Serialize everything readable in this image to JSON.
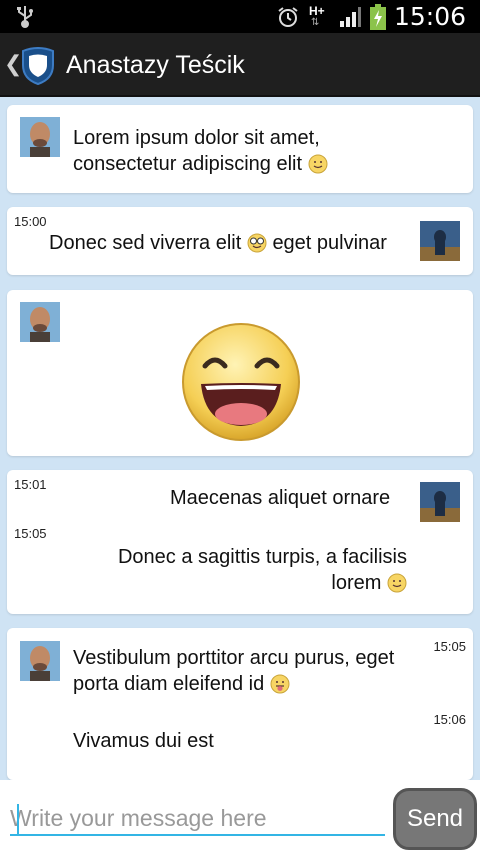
{
  "status_bar": {
    "time": "15:06",
    "network_type": "H+",
    "icons": [
      "usb-icon",
      "alarm-icon",
      "signal-icon",
      "battery-charging-icon"
    ]
  },
  "action_bar": {
    "title": "Anastazy Teścik",
    "icons": [
      "back-chevron-icon",
      "shield-logo-icon"
    ]
  },
  "messages": [
    {
      "text": "Lorem ipsum dolor sit amet, consectetur adipiscing elit",
      "line1": "Lorem ipsum dolor sit amet,",
      "line2": "consectetur adipiscing elit",
      "emoji": "smile",
      "sender": "contact"
    },
    {
      "time": "15:00",
      "text_a": "Donec sed viverra elit",
      "text_b": "eget pulvinar",
      "emoji": "nerd",
      "sender": "me"
    },
    {
      "emoji": "laughing-large",
      "sender": "contact"
    },
    {
      "time": "15:01",
      "text": "Maecenas aliquet ornare",
      "sender": "me"
    },
    {
      "time": "15:05",
      "line1": "Donec a sagittis turpis, a facilisis",
      "line2": "lorem",
      "emoji": "smile",
      "sender": "me"
    },
    {
      "time": "15:05",
      "line1": "Vestibulum porttitor arcu purus, eget",
      "line2": "porta diam eleifend id",
      "emoji": "tongue",
      "sender": "contact"
    },
    {
      "time": "15:06",
      "text": "Vivamus dui est",
      "sender": "contact"
    }
  ],
  "composer": {
    "placeholder": "Write your message here",
    "send_label": "Send"
  },
  "colors": {
    "chat_background": "#cfe3f4",
    "accent": "#33b5e5",
    "action_bar": "#1f1f1f"
  }
}
